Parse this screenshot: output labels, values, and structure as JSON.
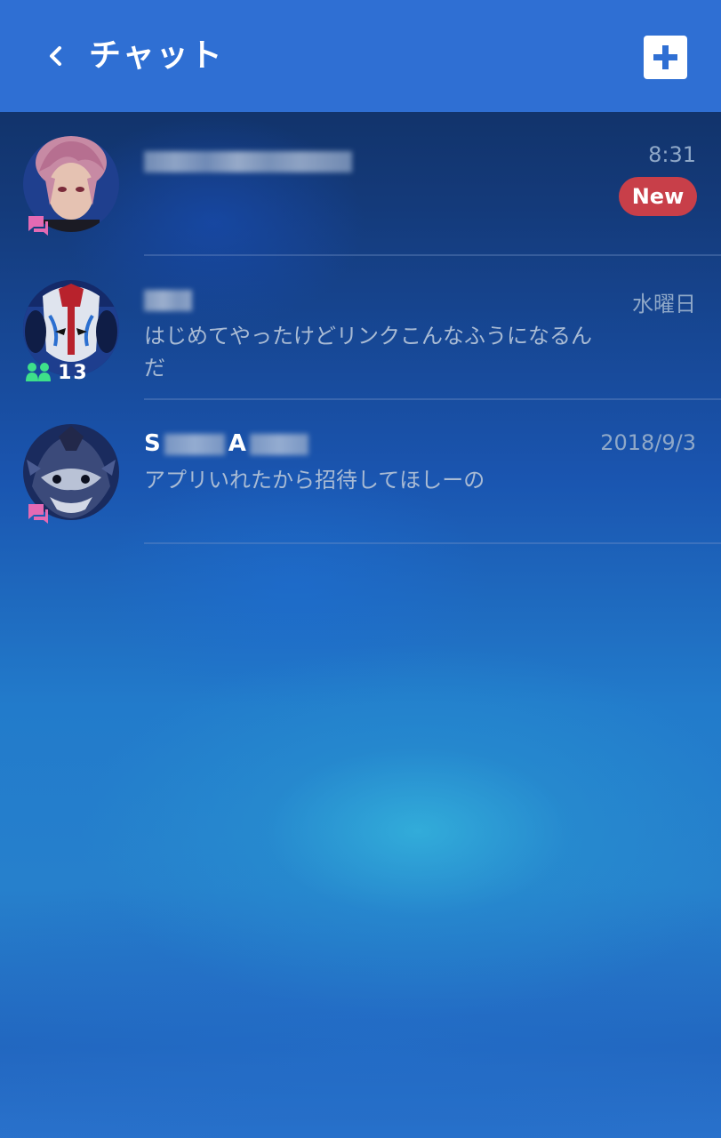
{
  "header": {
    "title": "チャット",
    "back_icon": "chevron-left-icon",
    "add_icon": "plus-icon"
  },
  "chats": [
    {
      "name": "",
      "time": "8:31",
      "badge": "New",
      "preview": "",
      "type_icon": "chat-bubble-icon"
    },
    {
      "name": "",
      "time": "水曜日",
      "preview": "はじめてやったけどリンクこんなふうになるんだ",
      "member_count": "13",
      "type_icon": "group-icon"
    },
    {
      "name_first": "S",
      "name_second": "A",
      "time": "2018/9/3",
      "preview": "アプリいれたから招待してほしーの",
      "type_icon": "chat-bubble-icon"
    }
  ],
  "colors": {
    "header_bg": "#2f6fd3",
    "new_badge": "#c83f49",
    "chat_icon": "#e46ab3",
    "group_icon": "#3ee08a"
  }
}
